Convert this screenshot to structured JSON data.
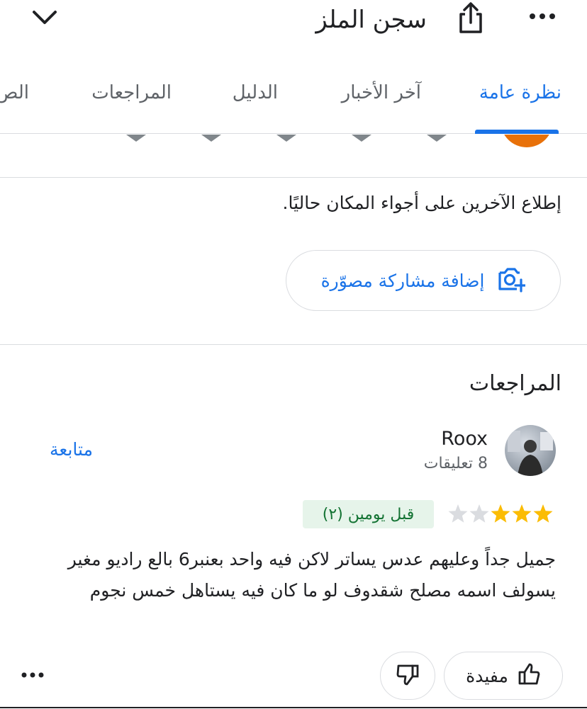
{
  "header": {
    "title": "سجن الملز",
    "collapse_icon": "chevron-down-icon",
    "share_icon": "share-icon",
    "more_icon": "more-horizontal-icon"
  },
  "tabs": [
    {
      "label": "نظرة عامة",
      "active": true
    },
    {
      "label": "آخر الأخبار",
      "active": false
    },
    {
      "label": "الدليل",
      "active": false
    },
    {
      "label": "المراجعات",
      "active": false
    },
    {
      "label": "الص",
      "active": false
    }
  ],
  "rating_prompt": {
    "stars": 5,
    "rated": 0
  },
  "vibe": {
    "text": "إطلاع الآخرين على أجواء المكان حاليًا.",
    "add_photo_label": "إضافة مشاركة مصوّرة"
  },
  "reviews": {
    "heading": "المراجعات",
    "items": [
      {
        "author": "Roox",
        "meta": "8 تعليقات",
        "follow_label": "متابعة",
        "rating": 3,
        "max_rating": 5,
        "time": "قبل يومين (٢)",
        "text": "جميل جداً وعليهم عدس يساتر لاكن فيه واحد بعنبر6 بالع راديو مغير يسولف اسمه مصلح شقدوف لو ما كان فيه يستاهل خمس نجوم",
        "helpful_label": "مفيدة"
      }
    ]
  },
  "colors": {
    "accent": "#1a73e8",
    "star_filled": "#fbbc04",
    "star_empty": "#dadce0",
    "badge_bg": "#e6f4ea",
    "badge_text": "#137333"
  }
}
